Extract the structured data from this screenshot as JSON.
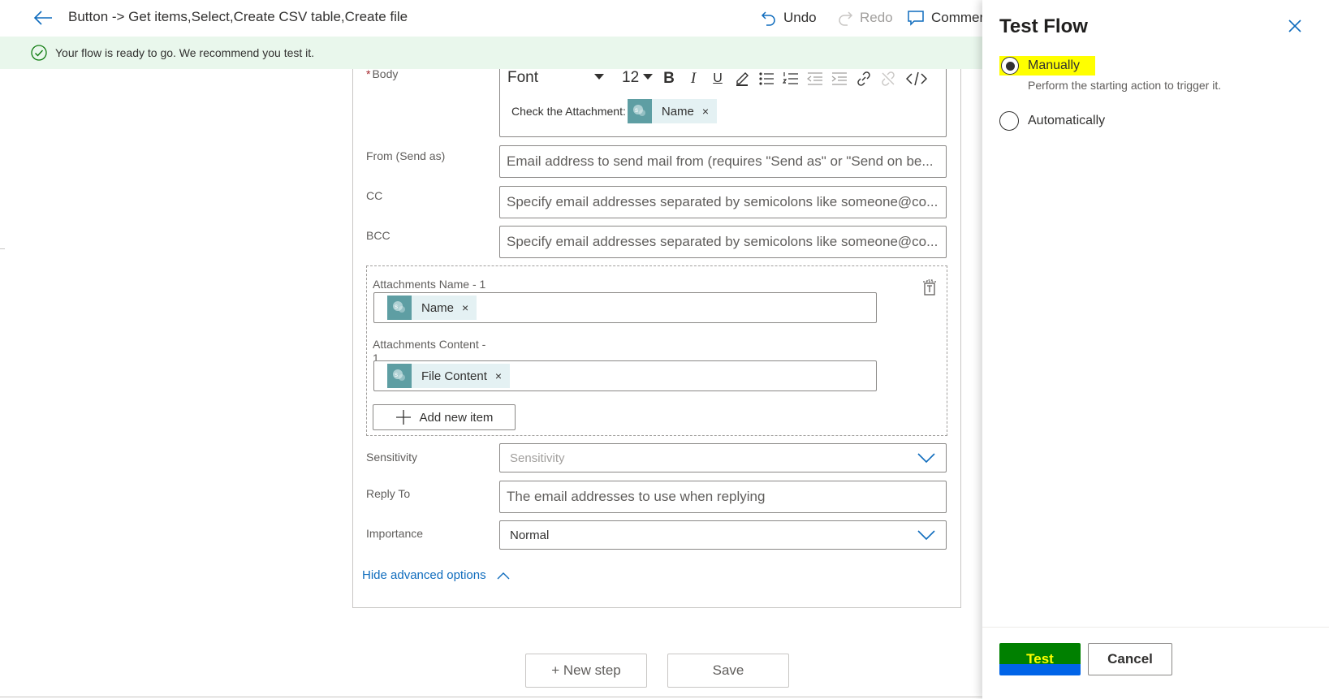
{
  "header": {
    "title": "Button -> Get items,Select,Create CSV table,Create file",
    "undo_label": "Undo",
    "redo_label": "Redo",
    "comments_label": "Commer"
  },
  "notice": {
    "text": "Your flow is ready to go. We recommend you test it."
  },
  "form": {
    "body": {
      "required_mark": "*",
      "label": "Body",
      "font_label": "Font",
      "font_size": "12",
      "content_text": "Check the Attachment:",
      "token_label": "Name",
      "token_close": "×"
    },
    "from": {
      "label": "From (Send as)",
      "placeholder": "Email address to send mail from (requires \"Send as\" or \"Send on be..."
    },
    "cc": {
      "label": "CC",
      "placeholder": "Specify email addresses separated by semicolons like someone@co..."
    },
    "bcc": {
      "label": "BCC",
      "placeholder": "Specify email addresses separated by semicolons like someone@co..."
    },
    "attachments": {
      "name_label": "Attachments Name - 1",
      "name_token": "Name",
      "content_label_line1": "Attachments Content -",
      "content_label_line2": "1",
      "content_token": "File Content",
      "token_close": "×",
      "add_item_label": "Add new item"
    },
    "sensitivity": {
      "label": "Sensitivity",
      "placeholder": "Sensitivity"
    },
    "reply_to": {
      "label": "Reply To",
      "placeholder": "The email addresses to use when replying"
    },
    "importance": {
      "label": "Importance",
      "value": "Normal"
    },
    "hide_advanced_label": "Hide advanced options"
  },
  "actions": {
    "new_step_label": "+ New step",
    "save_label": "Save"
  },
  "panel": {
    "title": "Test Flow",
    "options": [
      {
        "label": "Manually",
        "description": "Perform the starting action to trigger it.",
        "selected": true
      },
      {
        "label": "Automatically",
        "selected": false
      }
    ],
    "test_label": "Test",
    "cancel_label": "Cancel"
  },
  "colors": {
    "accent": "#0f6cbd",
    "notice_bg": "#e9f7ec",
    "success_green": "#107c10",
    "token_bg": "#e4f1f3",
    "token_icon_bg": "#5e9ea3",
    "highlight": "#ffff00",
    "test_button_green": "#008000",
    "test_button_blue": "#0064e8"
  },
  "icons": {
    "back": "back-arrow-icon",
    "undo": "undo-icon",
    "redo": "redo-icon",
    "comments": "comment-icon",
    "notice": "check-circle-icon",
    "token": "sharepoint-icon",
    "delete_item": "delete-item-icon",
    "add": "plus-icon",
    "dropdown": "chevron-down-icon",
    "collapse": "chevron-up-icon",
    "close": "close-icon"
  }
}
